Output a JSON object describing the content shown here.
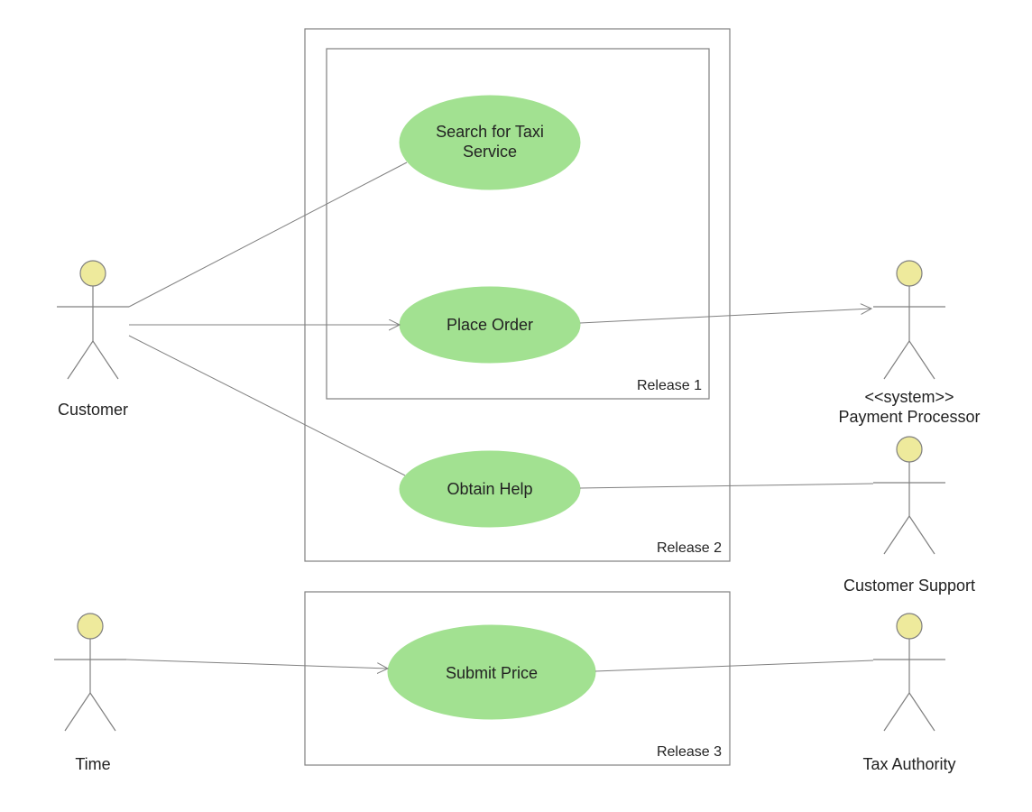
{
  "actors": {
    "customer": {
      "label": "Customer"
    },
    "time": {
      "label": "Time"
    },
    "payment_processor": {
      "stereotype": "<<system>>",
      "label": "Payment Processor"
    },
    "customer_support": {
      "label": "Customer Support"
    },
    "tax_authority": {
      "label": "Tax Authority"
    }
  },
  "usecases": {
    "search_taxi": {
      "line1": "Search for Taxi",
      "line2": "Service"
    },
    "place_order": {
      "label": "Place Order"
    },
    "obtain_help": {
      "label": "Obtain Help"
    },
    "submit_price": {
      "label": "Submit Price"
    }
  },
  "boundaries": {
    "release1": {
      "label": "Release 1"
    },
    "release2": {
      "label": "Release 2"
    },
    "release3": {
      "label": "Release 3"
    }
  }
}
